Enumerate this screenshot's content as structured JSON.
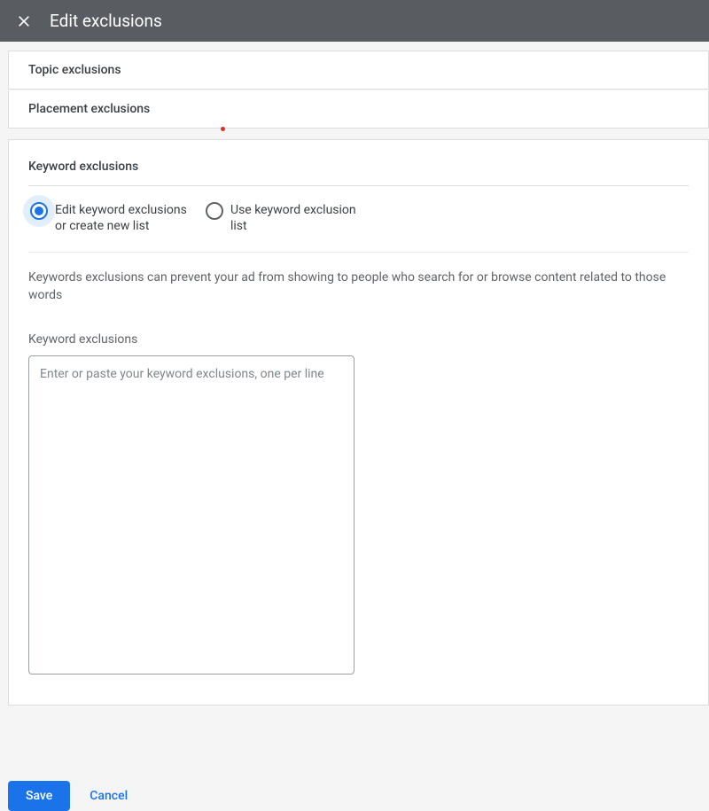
{
  "header": {
    "title": "Edit exclusions"
  },
  "sections": {
    "topic": {
      "title": "Topic exclusions"
    },
    "placement": {
      "title": "Placement exclusions"
    },
    "keyword": {
      "title": "Keyword exclusions",
      "radio_options": {
        "edit": "Edit keyword exclusions or create new list",
        "use": "Use keyword exclusion list"
      },
      "description": "Keywords exclusions can prevent your ad from showing to people who search for or browse content related to those words",
      "field_label": "Keyword exclusions",
      "textarea_placeholder": "Enter or paste your keyword exclusions, one per line",
      "textarea_value": ""
    }
  },
  "footer": {
    "save_label": "Save",
    "cancel_label": "Cancel"
  }
}
